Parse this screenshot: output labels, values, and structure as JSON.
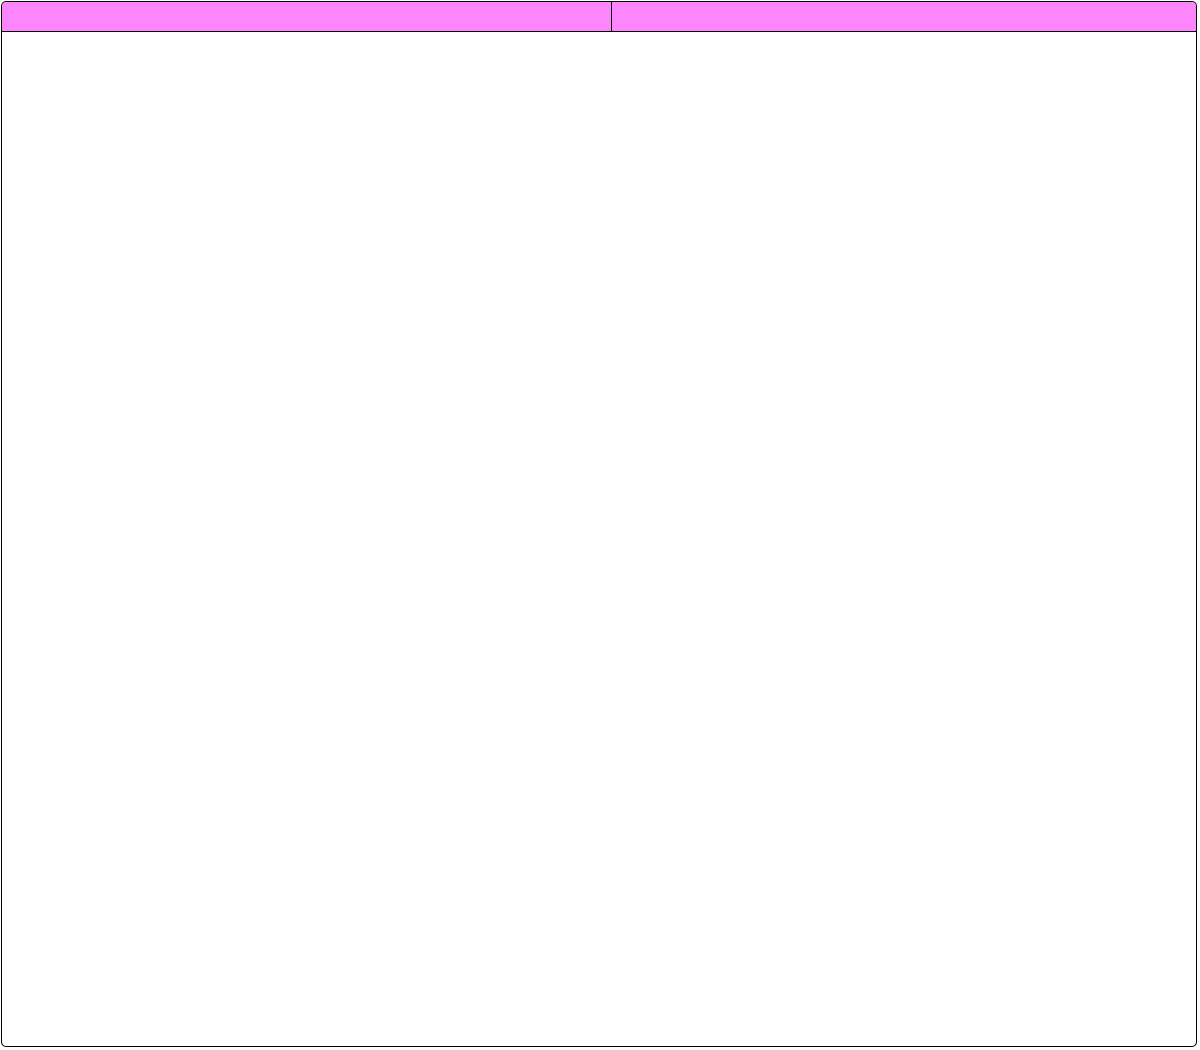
{
  "diagram": {
    "header_color": "#fd86fd",
    "border_color": "#000000",
    "background_color": "#ffffff",
    "columns": [
      {
        "label": ""
      },
      {
        "label": ""
      }
    ]
  }
}
